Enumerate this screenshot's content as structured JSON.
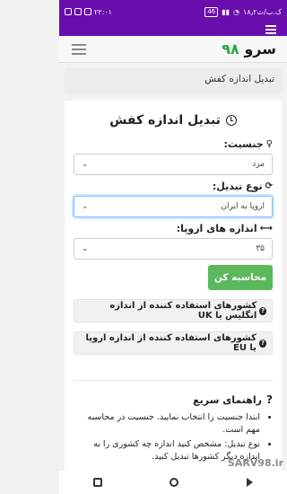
{
  "status": {
    "time": "۲۲:۰۱",
    "network": "۱۸٫۲ک.ب/ث",
    "battery": "46"
  },
  "header": {
    "brand_text": "سرو",
    "brand_num": "۹۸",
    "brand_color": "#28a745",
    "top_color": "#6a0dad"
  },
  "breadcrumb": {
    "text": "تبدیل اندازه کفش"
  },
  "form": {
    "title": "تبدیل اندازه کفش",
    "gender_label": "جنسیت:",
    "gender_value": "مرد",
    "conversion_label": "نوع تبدیل:",
    "conversion_value": "اروپا به ایران",
    "size_label": "اندازه های اروپا:",
    "size_value": "۳۵",
    "calc_button": "محاسبه کن",
    "calc_color": "#5cb85c"
  },
  "collapses": {
    "uk": "کشورهای استفاده کننده از اندازه انگلیس یا UK",
    "eu": "کشورهای استفاده کننده از اندازه اروپا یا EU"
  },
  "guide": {
    "title": "راهنمای سریع",
    "item1": "ابتدا جنسیت را انتخاب نمایید. جنسیت در محاسبه مهم است.",
    "item2": "نوع تبدیل: مشخص کنید اندازه چه کشوری را به اندازه دیگر کشورها تبدیل کنید."
  },
  "watermark": "SARV98.ir"
}
